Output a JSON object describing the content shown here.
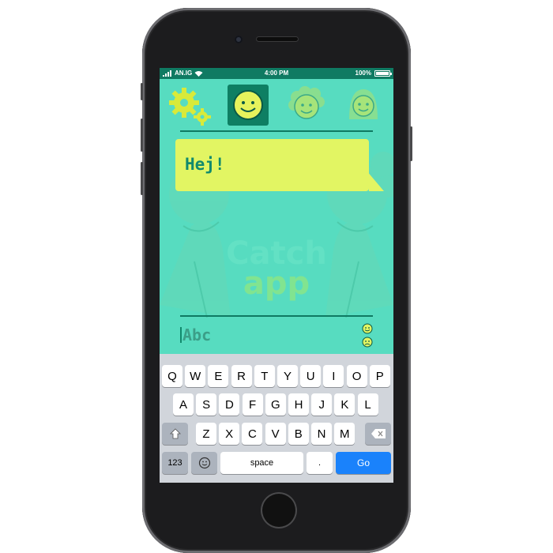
{
  "status_bar": {
    "carrier": "AN.IG",
    "time": "4:00 PM",
    "battery": "100%"
  },
  "header": {
    "settings_icon": "gear-icon",
    "avatars": [
      {
        "name": "smiley-face-icon",
        "selected": true
      },
      {
        "name": "curly-hair-face-icon",
        "selected": false
      },
      {
        "name": "long-hair-face-icon",
        "selected": false
      }
    ]
  },
  "chat": {
    "bubble_text": "Hej!"
  },
  "watermark": {
    "line1": "Catch",
    "line2": "app"
  },
  "compose": {
    "value": "Abc",
    "emoji": [
      "happy-face-icon",
      "sad-face-icon"
    ]
  },
  "keyboard": {
    "row1": [
      "Q",
      "W",
      "E",
      "R",
      "T",
      "Y",
      "U",
      "I",
      "O",
      "P"
    ],
    "row2": [
      "A",
      "S",
      "D",
      "F",
      "G",
      "H",
      "J",
      "K",
      "L"
    ],
    "row3": [
      "Z",
      "X",
      "C",
      "V",
      "B",
      "N",
      "M"
    ],
    "numbers_label": "123",
    "space_label": "space",
    "period_label": ".",
    "go_label": "Go"
  },
  "colors": {
    "background": "#57dcc0",
    "statusbar": "#0f7a62",
    "bubble": "#e2f563",
    "accent": "#118a6d",
    "go_key": "#1a82fb"
  }
}
